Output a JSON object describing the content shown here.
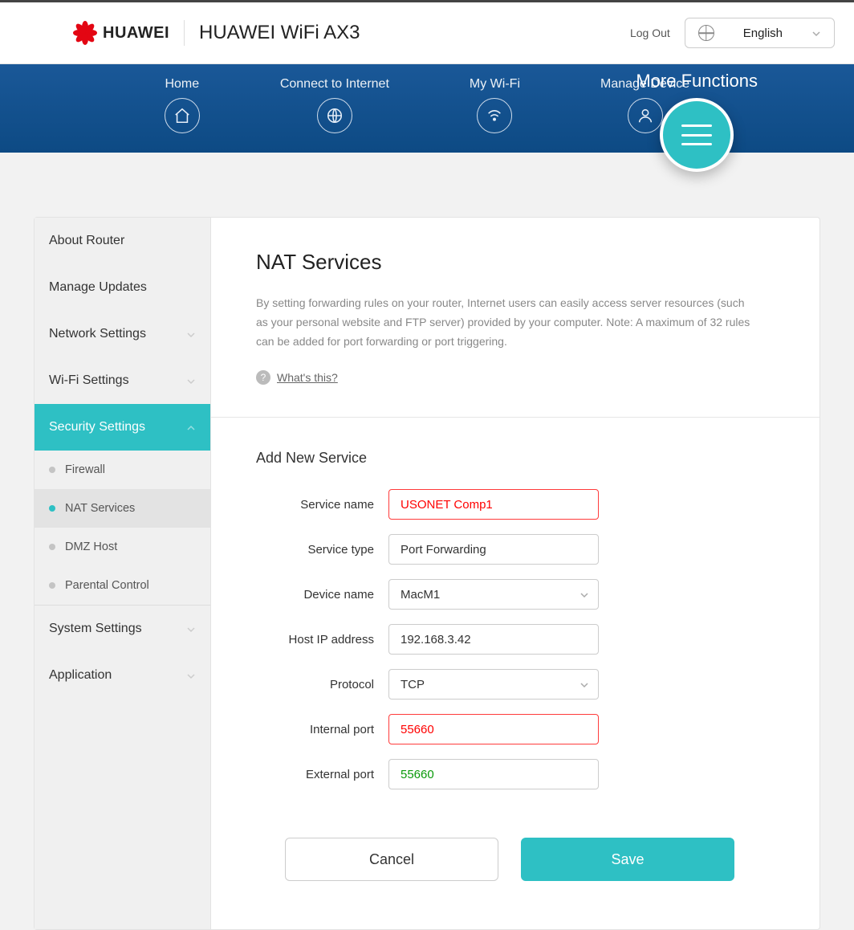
{
  "header": {
    "brand": "HUAWEI",
    "product": "HUAWEI WiFi AX3",
    "logout": "Log Out",
    "language": "English"
  },
  "nav": {
    "home": "Home",
    "internet": "Connect to Internet",
    "wifi": "My Wi-Fi",
    "manage": "Manage Device",
    "more": "More Functions"
  },
  "side": {
    "about": "About Router",
    "updates": "Manage Updates",
    "network": "Network Settings",
    "wifi": "Wi-Fi Settings",
    "security": "Security Settings",
    "sub": {
      "firewall": "Firewall",
      "nat": "NAT Services",
      "dmz": "DMZ Host",
      "parental": "Parental Control"
    },
    "system": "System Settings",
    "application": "Application"
  },
  "content": {
    "title": "NAT Services",
    "desc": "By setting forwarding rules on your router, Internet users can easily access server resources (such as your personal website and FTP server) provided by your computer. Note: A maximum of 32 rules can be added for port forwarding or port triggering.",
    "whats": "What's this?",
    "add_title": "Add New Service",
    "labels": {
      "service_name": "Service name",
      "service_type": "Service type",
      "device_name": "Device name",
      "host_ip": "Host IP address",
      "protocol": "Protocol",
      "internal_port": "Internal port",
      "external_port": "External port"
    },
    "values": {
      "service_name": "USONET Comp1",
      "service_type": "Port Forwarding",
      "device_name": "MacM1",
      "host_ip": "192.168.3.42",
      "protocol": "TCP",
      "internal_port": "55660",
      "external_port": "55660"
    },
    "cancel": "Cancel",
    "save": "Save"
  }
}
